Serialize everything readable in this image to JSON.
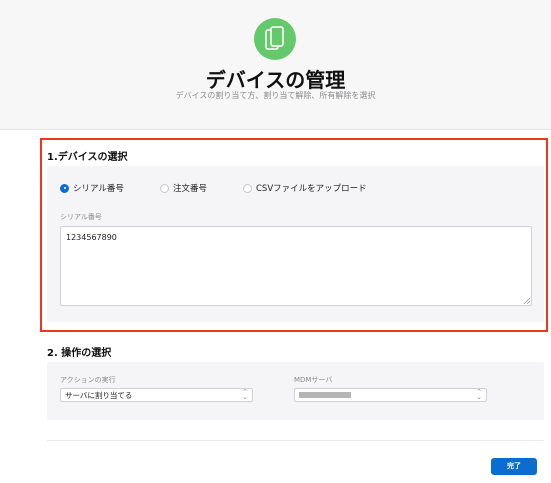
{
  "header": {
    "icon": "devices-icon",
    "title": "デバイスの管理",
    "subtitle": "デバイスの割り当て方、割り当て解除、所有解除を選択"
  },
  "section1": {
    "heading": "1.デバイスの選択",
    "radios": [
      {
        "label": "シリアル番号",
        "checked": true
      },
      {
        "label": "注文番号",
        "checked": false
      },
      {
        "label": "CSVファイルをアップロード",
        "checked": false
      }
    ],
    "field_label": "シリアル番号",
    "field_value": "1234567890"
  },
  "section2": {
    "heading": "2. 操作の選択",
    "action_label": "アクションの実行",
    "action_value": "サーバに割り当てる",
    "server_label": "MDMサーバ",
    "server_value": ""
  },
  "footer": {
    "done_label": "完了"
  },
  "colors": {
    "accent": "#0a6ed1",
    "highlight": "#e8391c",
    "icon_bg": "#63c96a"
  }
}
